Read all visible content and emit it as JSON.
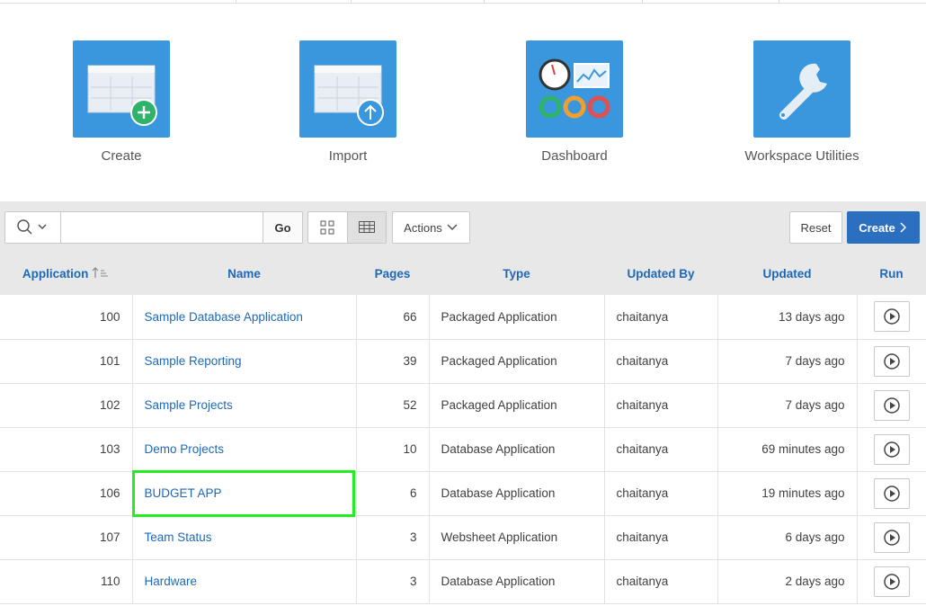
{
  "tiles": [
    {
      "label": "Create",
      "icon": "create-app-icon"
    },
    {
      "label": "Import",
      "icon": "import-app-icon"
    },
    {
      "label": "Dashboard",
      "icon": "dashboard-icon"
    },
    {
      "label": "Workspace Utilities",
      "icon": "wrench-icon"
    }
  ],
  "toolbar": {
    "search_value": "",
    "go_label": "Go",
    "actions_label": "Actions",
    "reset_label": "Reset",
    "create_label": "Create"
  },
  "columns": [
    "Application",
    "Name",
    "Pages",
    "Type",
    "Updated By",
    "Updated",
    "Run"
  ],
  "rows": [
    {
      "id": "100",
      "name": "Sample Database Application",
      "pages": "66",
      "type": "Packaged Application",
      "updated_by": "chaitanya",
      "updated": "13 days ago"
    },
    {
      "id": "101",
      "name": "Sample Reporting",
      "pages": "39",
      "type": "Packaged Application",
      "updated_by": "chaitanya",
      "updated": "7 days ago"
    },
    {
      "id": "102",
      "name": "Sample Projects",
      "pages": "52",
      "type": "Packaged Application",
      "updated_by": "chaitanya",
      "updated": "7 days ago"
    },
    {
      "id": "103",
      "name": "Demo Projects",
      "pages": "10",
      "type": "Database Application",
      "updated_by": "chaitanya",
      "updated": "69 minutes ago"
    },
    {
      "id": "106",
      "name": "BUDGET APP",
      "pages": "6",
      "type": "Database Application",
      "updated_by": "chaitanya",
      "updated": "19 minutes ago"
    },
    {
      "id": "107",
      "name": "Team Status",
      "pages": "3",
      "type": "Websheet Application",
      "updated_by": "chaitanya",
      "updated": "6 days ago"
    },
    {
      "id": "110",
      "name": "Hardware",
      "pages": "3",
      "type": "Database Application",
      "updated_by": "chaitanya",
      "updated": "2 days ago"
    }
  ],
  "colors": {
    "accent": "#3a96dd",
    "link": "#1e69b7",
    "highlight": "#22ee22",
    "create_button": "#2a6fc0"
  }
}
